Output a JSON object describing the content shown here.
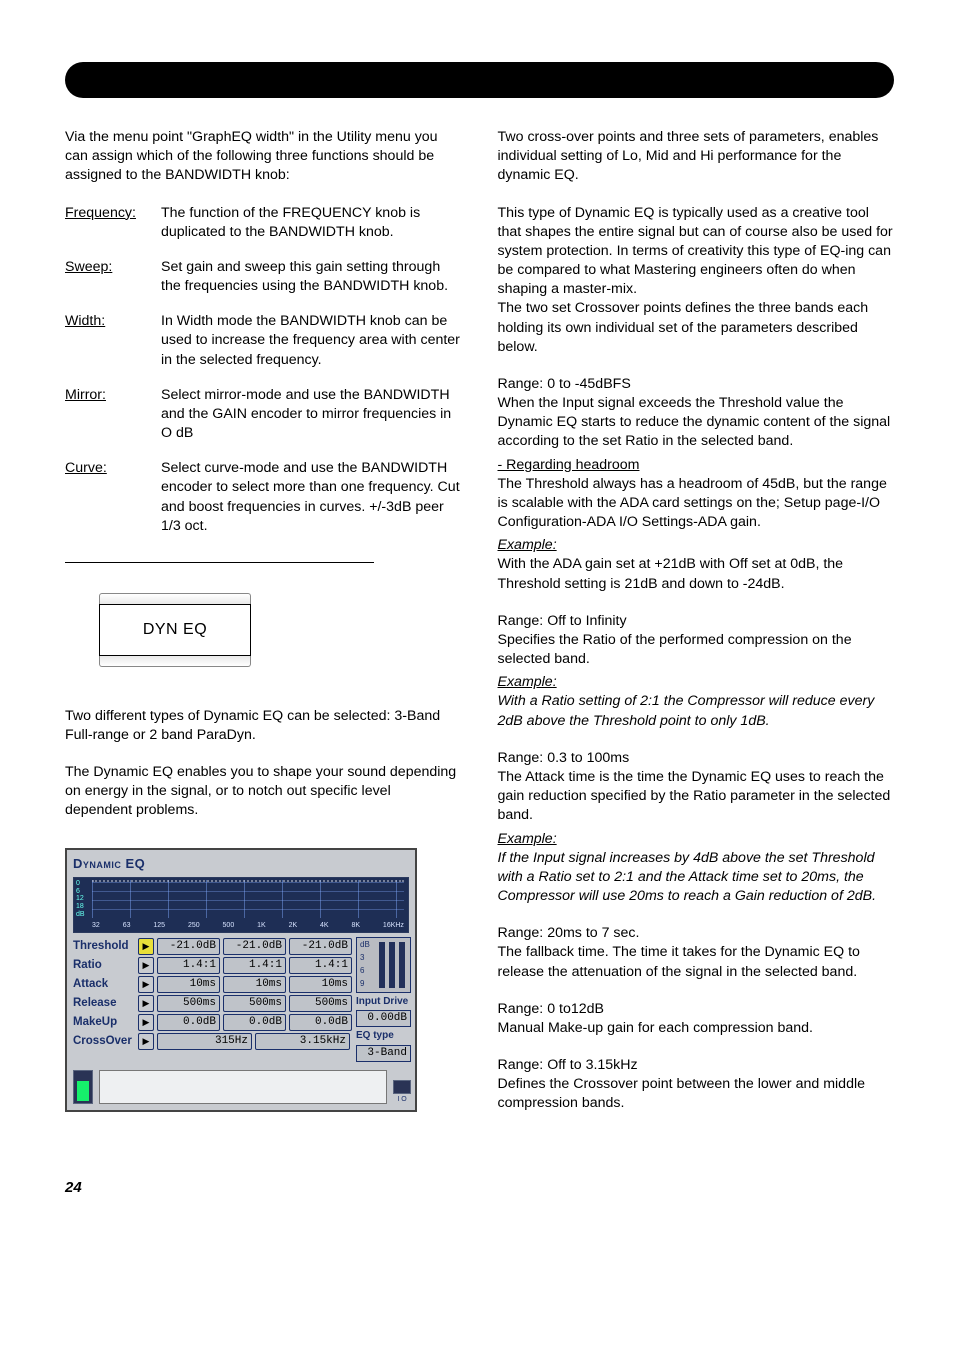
{
  "page_number": "24",
  "left": {
    "intro": "Via the menu point \"GraphEQ width\" in the Utility menu you can assign which of the following three functions should be assigned to the BANDWIDTH knob:",
    "rows": [
      {
        "label": "Frequency:",
        "desc": "The function of the FREQUENCY knob is duplicated to the BANDWIDTH knob."
      },
      {
        "label": "Sweep:",
        "desc": "Set gain and sweep this gain setting through the frequencies using the BANDWIDTH knob."
      },
      {
        "label": "Width:",
        "desc": "In Width mode the BANDWIDTH knob can be used to increase the frequency area with center in the selected frequency."
      },
      {
        "label": "Mirror:",
        "desc": "Select mirror-mode and use the BANDWIDTH and the GAIN encoder to mirror frequencies in O dB"
      },
      {
        "label": "Curve:",
        "desc": "Select curve-mode and use the BANDWIDTH encoder to select more than one frequency. Cut and boost frequencies in curves. +/-3dB peer 1/3 oct."
      }
    ],
    "tab_label": "DYN EQ",
    "para1": "Two different types of Dynamic EQ can be selected: 3-Band Full-range or 2 band ParaDyn.",
    "para2": "The Dynamic EQ enables you to shape your sound depending on energy in the signal, or to notch out specific level dependent problems."
  },
  "deq": {
    "title": "Dynamic EQ",
    "yticks": [
      "0",
      "6",
      "12",
      "18",
      "dB"
    ],
    "xticks": [
      "32",
      "63",
      "125",
      "250",
      "500",
      "1K",
      "2K",
      "4K",
      "8K",
      "16KHz"
    ],
    "rows": [
      {
        "label": "Threshold",
        "active": true,
        "c1": "-21.0dB",
        "c2": "-21.0dB",
        "c3": "-21.0dB"
      },
      {
        "label": "Ratio",
        "active": false,
        "c1": "1.4:1",
        "c2": "1.4:1",
        "c3": "1.4:1"
      },
      {
        "label": "Attack",
        "active": false,
        "c1": "10ms",
        "c2": "10ms",
        "c3": "10ms"
      },
      {
        "label": "Release",
        "active": false,
        "c1": "500ms",
        "c2": "500ms",
        "c3": "500ms"
      },
      {
        "label": "MakeUp",
        "active": false,
        "c1": "0.0dB",
        "c2": "0.0dB",
        "c3": "0.0dB"
      }
    ],
    "crossover": {
      "label": "CrossOver",
      "c1": "315Hz",
      "c2": "3.15kHz"
    },
    "side": {
      "meter_ticks": [
        "dB",
        "3",
        "6",
        "9"
      ],
      "drive_label": "Input Drive",
      "drive_value": "0.00dB",
      "type_label": "EQ type",
      "type_value": "3-Band"
    },
    "foot_caption": "I  O"
  },
  "right": {
    "para1": "Two cross-over points and three sets of parameters, enables individual setting of Lo, Mid and Hi performance for the dynamic EQ.",
    "para2a": "This type of Dynamic EQ is typically used as a creative tool that shapes the entire signal but can of course also be used for system protection. In terms of creativity this type of EQ-ing can be compared to what Mastering engineers often do when shaping a master-mix.",
    "para2b": "The two set Crossover points defines the three bands each holding its own individual set of the parameters described below.",
    "threshold": {
      "range": "Range: 0 to -45dBFS",
      "body": "When the Input signal exceeds the Threshold value the Dynamic EQ starts to reduce the dynamic content of the signal according to the set Ratio in the selected band.",
      "sub_head": " - Regarding headroom",
      "sub_body": "The Threshold always has a headroom of 45dB, but the range is scalable with the ADA card settings on the; Setup page-I/O Configuration-ADA I/O Settings-ADA gain.",
      "ex_label": "Example:",
      "ex_body": "With the ADA gain set at +21dB with Off set at 0dB, the Threshold setting is 21dB and down to -24dB."
    },
    "ratio": {
      "range": "Range: Off to Infinity",
      "body": "Specifies the Ratio of the performed compression on the selected band.",
      "ex_label": "Example:",
      "ex_body": "With a Ratio setting of 2:1 the Compressor will reduce every 2dB above the Threshold point to only 1dB."
    },
    "attack": {
      "range": "Range: 0.3 to 100ms",
      "body": "The Attack time is the time the Dynamic EQ uses to reach the gain reduction specified by the Ratio parameter in the selected band.",
      "ex_label": "Example:",
      "ex_body": "If the Input signal increases by 4dB above the set Threshold with a Ratio set to 2:1 and the Attack time set to 20ms, the Compressor will use 20ms to reach a Gain reduction of 2dB."
    },
    "release": {
      "range": "Range: 20ms to 7 sec.",
      "body": "The fallback time. The time it takes for the Dynamic EQ to release the attenuation of the signal in the selected band."
    },
    "makeup": {
      "range": "Range: 0 to12dB",
      "body": "Manual Make-up gain for each compression band."
    },
    "crossover": {
      "range": "Range: Off to 3.15kHz",
      "body": "Defines the Crossover point between the lower and middle compression bands."
    }
  }
}
